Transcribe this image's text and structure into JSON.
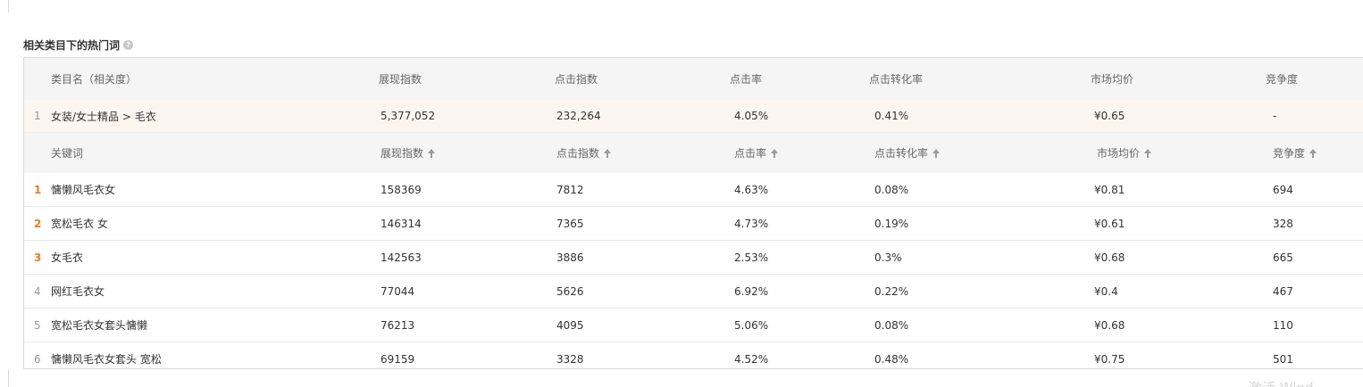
{
  "section": {
    "title": "相关类目下的热门词",
    "help_icon": "question-circle-icon"
  },
  "category_table": {
    "headers": [
      "类目名（相关度）",
      "展现指数",
      "点击指数",
      "点击率",
      "点击转化率",
      "市场均价",
      "竞争度"
    ],
    "row": {
      "rank": "1",
      "name": "女装/女士精品 > 毛衣",
      "impressions": "5,377,052",
      "clicks": "232,264",
      "ctr": "4.05%",
      "cvr": "0.41%",
      "avg_price": "¥0.65",
      "competition": "-"
    }
  },
  "keyword_table": {
    "headers": [
      "关键词",
      "展现指数",
      "点击指数",
      "点击率",
      "点击转化率",
      "市场均价",
      "竞争度"
    ],
    "sort_icon": "sort-arrow-up-icon",
    "rows": [
      {
        "rank": "1",
        "keyword": "慵懒风毛衣女",
        "impressions": "158369",
        "clicks": "7812",
        "ctr": "4.63%",
        "cvr": "0.08%",
        "avg_price": "¥0.81",
        "competition": "694"
      },
      {
        "rank": "2",
        "keyword": "宽松毛衣 女",
        "impressions": "146314",
        "clicks": "7365",
        "ctr": "4.73%",
        "cvr": "0.19%",
        "avg_price": "¥0.61",
        "competition": "328"
      },
      {
        "rank": "3",
        "keyword": "女毛衣",
        "impressions": "142563",
        "clicks": "3886",
        "ctr": "2.53%",
        "cvr": "0.3%",
        "avg_price": "¥0.68",
        "competition": "665"
      },
      {
        "rank": "4",
        "keyword": "网红毛衣女",
        "impressions": "77044",
        "clicks": "5626",
        "ctr": "6.92%",
        "cvr": "0.22%",
        "avg_price": "¥0.4",
        "competition": "467"
      },
      {
        "rank": "5",
        "keyword": "宽松毛衣女套头慵懒",
        "impressions": "76213",
        "clicks": "4095",
        "ctr": "5.06%",
        "cvr": "0.08%",
        "avg_price": "¥0.68",
        "competition": "110"
      },
      {
        "rank": "6",
        "keyword": "慵懒风毛衣女套头 宽松",
        "impressions": "69159",
        "clicks": "3328",
        "ctr": "4.52%",
        "cvr": "0.48%",
        "avg_price": "¥0.75",
        "competition": "501"
      }
    ]
  },
  "colors": {
    "top_rank": "#f07c1a",
    "rank": "#999999",
    "header_bg": "#f5f5f5",
    "category_row_bg": "#fdf5f0"
  },
  "watermark": "激活 Wind"
}
